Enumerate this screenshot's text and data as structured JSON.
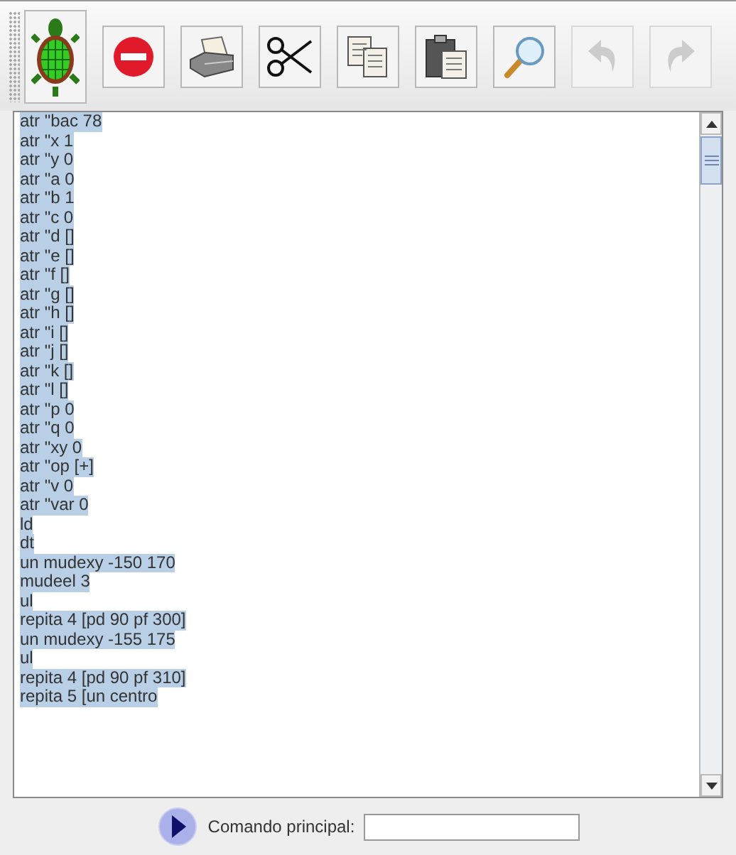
{
  "toolbar": [
    {
      "disabled": false
    },
    {
      "disabled": false
    },
    {
      "disabled": false
    },
    {
      "disabled": false
    },
    {
      "disabled": false
    },
    {
      "disabled": false
    },
    {
      "disabled": false
    },
    {
      "disabled": true
    },
    {
      "disabled": true
    }
  ],
  "editor": {
    "lines": [
      {
        "text": "atr \"bac 78",
        "selected": true
      },
      {
        "text": "atr \"x 1",
        "selected": true
      },
      {
        "text": "atr \"y 0",
        "selected": true
      },
      {
        "text": "atr \"a 0",
        "selected": true
      },
      {
        "text": "atr \"b 1",
        "selected": true
      },
      {
        "text": "atr \"c 0",
        "selected": true
      },
      {
        "text": "atr \"d []",
        "selected": true
      },
      {
        "text": "atr \"e []",
        "selected": true
      },
      {
        "text": "atr \"f []",
        "selected": true
      },
      {
        "text": "atr \"g []",
        "selected": true
      },
      {
        "text": "atr \"h []",
        "selected": true
      },
      {
        "text": "atr \"i []",
        "selected": true
      },
      {
        "text": "atr \"j []",
        "selected": true
      },
      {
        "text": "atr \"k []",
        "selected": true
      },
      {
        "text": "atr \"l []",
        "selected": true
      },
      {
        "text": "atr \"p 0",
        "selected": true
      },
      {
        "text": "atr \"q 0",
        "selected": true
      },
      {
        "text": "atr \"xy 0",
        "selected": true
      },
      {
        "text": "atr \"op [+]",
        "selected": true
      },
      {
        "text": "atr \"v 0",
        "selected": true
      },
      {
        "text": "atr \"var 0",
        "selected": true
      },
      {
        "text": "ld",
        "selected": true
      },
      {
        "text": "dt",
        "selected": true
      },
      {
        "text": "un mudexy -150 170",
        "selected": true
      },
      {
        "text": "mudeel 3",
        "selected": true
      },
      {
        "text": "ul",
        "selected": true
      },
      {
        "text": "repita 4 [pd 90 pf 300]",
        "selected": true
      },
      {
        "text": "un mudexy -155 175",
        "selected": true
      },
      {
        "text": "ul",
        "selected": true
      },
      {
        "text": "repita 4 [pd 90 pf 310]",
        "selected": true
      },
      {
        "text": "repita 5 [un centro",
        "selected": true
      }
    ]
  },
  "command": {
    "label": "Comando principal:"
  }
}
